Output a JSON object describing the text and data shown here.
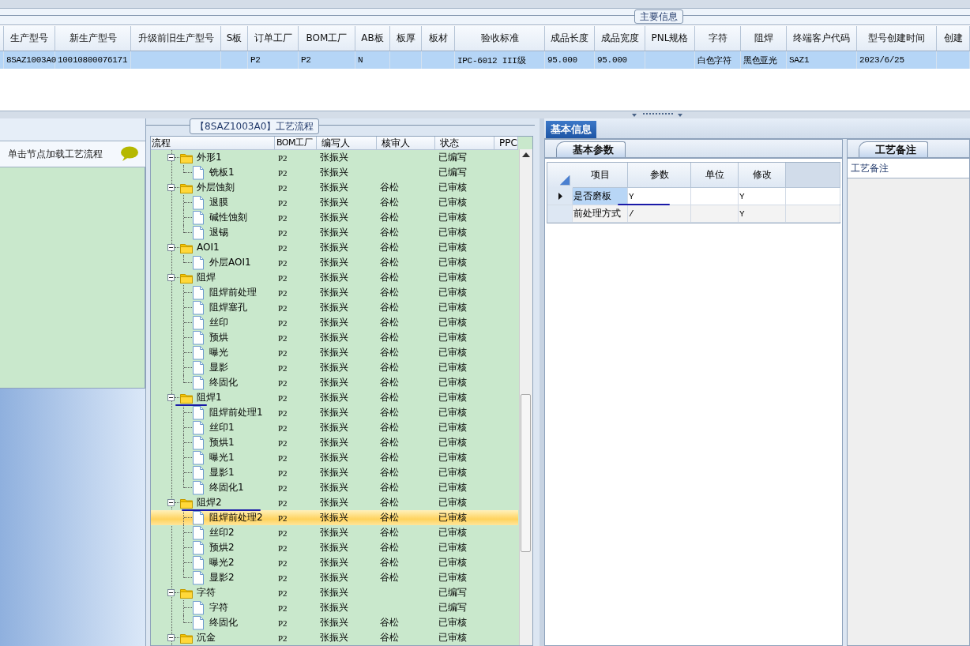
{
  "main_info": {
    "title": "主要信息",
    "columns": [
      "生产型号",
      "新生产型号",
      "升级前旧生产型号",
      "S板",
      "订单工厂",
      "BOM工厂",
      "AB板",
      "板厚",
      "板材",
      "验收标准",
      "成品长度",
      "成品宽度",
      "PNL规格",
      "字符",
      "阻焊",
      "终端客户代码",
      "型号创建时间",
      "创建"
    ],
    "rows": [
      {
        "selected": true,
        "cells": [
          "8SAZ1003A0",
          "10010800076171",
          null,
          null,
          "P2",
          "P2",
          "N",
          null,
          null,
          "IPC-6012 III级",
          "95.000",
          "95.000",
          null,
          "白色字符",
          "黑色亚光",
          "SAZ1",
          "2023/6/25",
          null
        ]
      }
    ]
  },
  "left_panel": {
    "hint": "单击节点加载工艺流程"
  },
  "process": {
    "title": "【8SAZ1003A0】工艺流程",
    "columns": [
      "流程",
      "BOM工厂",
      "编写人",
      "核审人",
      "状态",
      "PPC"
    ],
    "nodes": [
      {
        "kind": "folder",
        "name": "外形1",
        "bom": "P2",
        "writer": "张振兴",
        "status": "已编写",
        "expanded": true,
        "selected": false,
        "children": [
          {
            "kind": "file",
            "name": "铣板1",
            "bom": "P2",
            "writer": "张振兴",
            "status": "已编写",
            "selected": false
          }
        ]
      },
      {
        "kind": "folder",
        "name": "外层蚀刻",
        "bom": "P2",
        "writer": "张振兴",
        "reviewer": "谷松",
        "status": "已审核",
        "expanded": true,
        "selected": false,
        "children": [
          {
            "kind": "file",
            "name": "退膜",
            "bom": "P2",
            "writer": "张振兴",
            "reviewer": "谷松",
            "status": "已审核",
            "selected": false
          },
          {
            "kind": "file",
            "name": "碱性蚀刻",
            "bom": "P2",
            "writer": "张振兴",
            "reviewer": "谷松",
            "status": "已审核",
            "selected": false
          },
          {
            "kind": "file",
            "name": "退锡",
            "bom": "P2",
            "writer": "张振兴",
            "reviewer": "谷松",
            "status": "已审核",
            "selected": false
          }
        ]
      },
      {
        "kind": "folder",
        "name": "AOI1",
        "bom": "P2",
        "writer": "张振兴",
        "reviewer": "谷松",
        "status": "已审核",
        "expanded": true,
        "selected": false,
        "children": [
          {
            "kind": "file",
            "name": "外层AOI1",
            "bom": "P2",
            "writer": "张振兴",
            "reviewer": "谷松",
            "status": "已审核",
            "selected": false
          }
        ]
      },
      {
        "kind": "folder",
        "name": "阻焊",
        "bom": "P2",
        "writer": "张振兴",
        "reviewer": "谷松",
        "status": "已审核",
        "expanded": true,
        "selected": false,
        "children": [
          {
            "kind": "file",
            "name": "阻焊前处理",
            "bom": "P2",
            "writer": "张振兴",
            "reviewer": "谷松",
            "status": "已审核",
            "selected": false
          },
          {
            "kind": "file",
            "name": "阻焊塞孔",
            "bom": "P2",
            "writer": "张振兴",
            "reviewer": "谷松",
            "status": "已审核",
            "selected": false
          },
          {
            "kind": "file",
            "name": "丝印",
            "bom": "P2",
            "writer": "张振兴",
            "reviewer": "谷松",
            "status": "已审核",
            "selected": false
          },
          {
            "kind": "file",
            "name": "预烘",
            "bom": "P2",
            "writer": "张振兴",
            "reviewer": "谷松",
            "status": "已审核",
            "selected": false
          },
          {
            "kind": "file",
            "name": "曝光",
            "bom": "P2",
            "writer": "张振兴",
            "reviewer": "谷松",
            "status": "已审核",
            "selected": false
          },
          {
            "kind": "file",
            "name": "显影",
            "bom": "P2",
            "writer": "张振兴",
            "reviewer": "谷松",
            "status": "已审核",
            "selected": false
          },
          {
            "kind": "file",
            "name": "终固化",
            "bom": "P2",
            "writer": "张振兴",
            "reviewer": "谷松",
            "status": "已审核",
            "selected": false
          }
        ]
      },
      {
        "kind": "folder",
        "name": "阻焊1",
        "bom": "P2",
        "writer": "张振兴",
        "reviewer": "谷松",
        "status": "已审核",
        "expanded": true,
        "selected": false,
        "children": [
          {
            "kind": "file",
            "name": "阻焊前处理1",
            "bom": "P2",
            "writer": "张振兴",
            "reviewer": "谷松",
            "status": "已审核",
            "selected": false
          },
          {
            "kind": "file",
            "name": "丝印1",
            "bom": "P2",
            "writer": "张振兴",
            "reviewer": "谷松",
            "status": "已审核",
            "selected": false
          },
          {
            "kind": "file",
            "name": "预烘1",
            "bom": "P2",
            "writer": "张振兴",
            "reviewer": "谷松",
            "status": "已审核",
            "selected": false
          },
          {
            "kind": "file",
            "name": "曝光1",
            "bom": "P2",
            "writer": "张振兴",
            "reviewer": "谷松",
            "status": "已审核",
            "selected": false
          },
          {
            "kind": "file",
            "name": "显影1",
            "bom": "P2",
            "writer": "张振兴",
            "reviewer": "谷松",
            "status": "已审核",
            "selected": false
          },
          {
            "kind": "file",
            "name": "终固化1",
            "bom": "P2",
            "writer": "张振兴",
            "reviewer": "谷松",
            "status": "已审核",
            "selected": false
          }
        ]
      },
      {
        "kind": "folder",
        "name": "阻焊2",
        "bom": "P2",
        "writer": "张振兴",
        "reviewer": "谷松",
        "status": "已审核",
        "expanded": true,
        "selected": false,
        "children": [
          {
            "kind": "file",
            "name": "阻焊前处理2",
            "bom": "P2",
            "writer": "张振兴",
            "reviewer": "谷松",
            "status": "已审核",
            "selected": true
          },
          {
            "kind": "file",
            "name": "丝印2",
            "bom": "P2",
            "writer": "张振兴",
            "reviewer": "谷松",
            "status": "已审核",
            "selected": false
          },
          {
            "kind": "file",
            "name": "预烘2",
            "bom": "P2",
            "writer": "张振兴",
            "reviewer": "谷松",
            "status": "已审核",
            "selected": false
          },
          {
            "kind": "file",
            "name": "曝光2",
            "bom": "P2",
            "writer": "张振兴",
            "reviewer": "谷松",
            "status": "已审核",
            "selected": false
          },
          {
            "kind": "file",
            "name": "显影2",
            "bom": "P2",
            "writer": "张振兴",
            "reviewer": "谷松",
            "status": "已审核",
            "selected": false
          }
        ]
      },
      {
        "kind": "folder",
        "name": "字符",
        "bom": "P2",
        "writer": "张振兴",
        "status": "已编写",
        "expanded": true,
        "selected": false,
        "children": [
          {
            "kind": "file",
            "name": "字符",
            "bom": "P2",
            "writer": "张振兴",
            "status": "已编写",
            "selected": false
          },
          {
            "kind": "file",
            "name": "终固化",
            "bom": "P2",
            "writer": "张振兴",
            "reviewer": "谷松",
            "status": "已审核",
            "selected": false
          }
        ]
      },
      {
        "kind": "folder",
        "name": "沉金",
        "bom": "P2",
        "writer": "张振兴",
        "reviewer": "谷松",
        "status": "已审核",
        "expanded": true,
        "selected": false
      }
    ]
  },
  "basic_info": {
    "tab": "基本信息",
    "params": {
      "tab": "基本参数",
      "columns": [
        "项目",
        "参数",
        "单位",
        "修改"
      ],
      "rows": [
        {
          "selected": true,
          "cells": [
            "是否磨板",
            "Y",
            null,
            "Y"
          ]
        },
        {
          "selected": false,
          "cells": [
            "前处理方式",
            "/",
            null,
            "Y"
          ]
        }
      ]
    },
    "remarks": {
      "tab": "工艺备注",
      "label": "工艺备注"
    }
  }
}
